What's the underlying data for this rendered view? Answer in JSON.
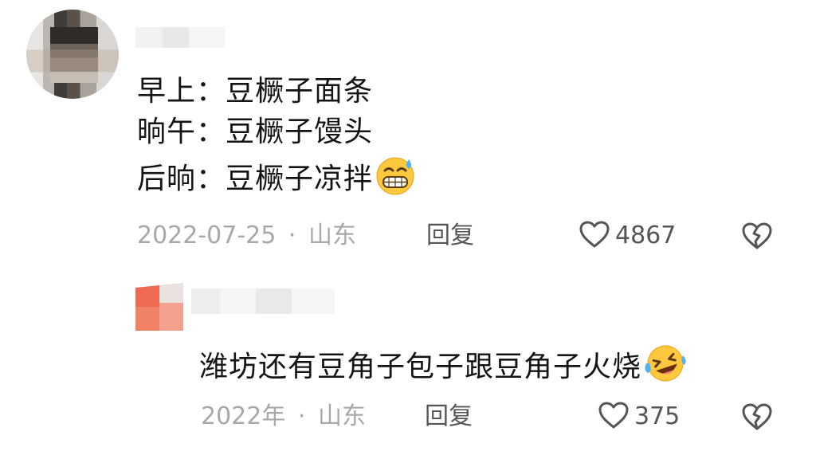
{
  "comment": {
    "lines": [
      {
        "time": "早上：",
        "text": "豆橛子面条"
      },
      {
        "time": "晌午：",
        "text": "豆橛子馒头"
      },
      {
        "time": "后晌：",
        "text": "豆橛子凉拌"
      }
    ],
    "date": "2022-07-25",
    "separator": "·",
    "location": "山东",
    "reply_label": "回复",
    "likes": "4867",
    "emoji": "grinning-sweat-emoji"
  },
  "reply": {
    "text": "潍坊还有豆角子包子跟豆角子火烧",
    "date": "2022年",
    "separator": "·",
    "location": "山东",
    "reply_label": "回复",
    "likes": "375",
    "emoji": "laughing-tears-emoji"
  },
  "colors": {
    "text": "#141414",
    "meta": "#a8a8a8",
    "action": "#555555"
  }
}
